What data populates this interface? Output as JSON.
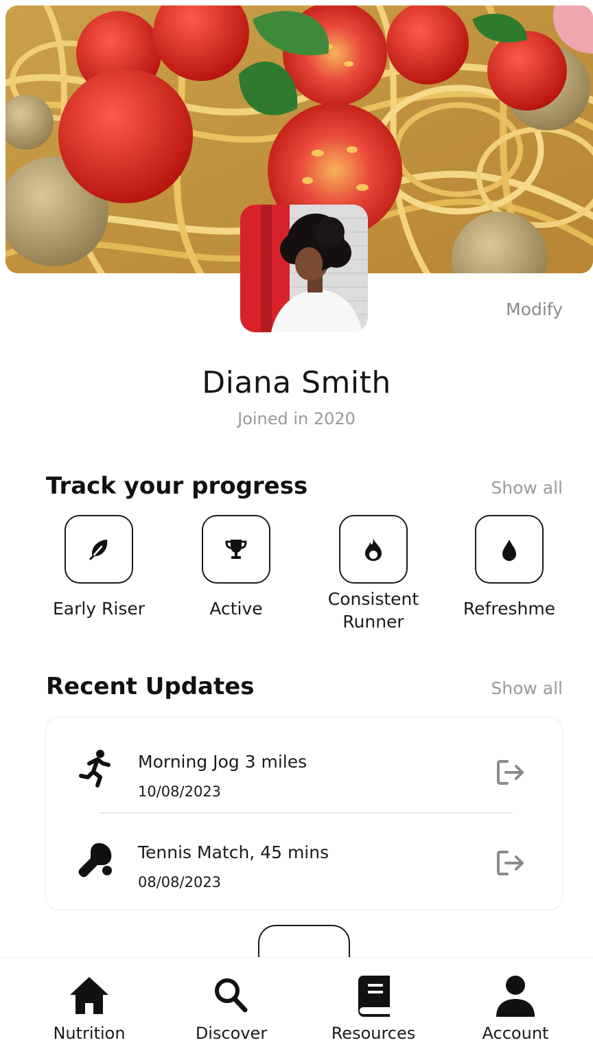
{
  "profile": {
    "modify_label": "Modify",
    "name": "Diana Smith",
    "joined": "Joined in 2020"
  },
  "progress": {
    "title": "Track your progress",
    "show_all": "Show all",
    "badges": [
      {
        "label": "Early Riser",
        "icon": "feather-icon"
      },
      {
        "label": "Active",
        "icon": "trophy-icon"
      },
      {
        "label": "Consistent Runner",
        "icon": "flame-icon"
      },
      {
        "label": "Refreshme",
        "icon": "water-drop-icon"
      }
    ]
  },
  "updates": {
    "title": "Recent Updates",
    "show_all": "Show all",
    "items": [
      {
        "title": "Morning Jog 3 miles",
        "date": "10/08/2023",
        "icon": "running-icon"
      },
      {
        "title": "Tennis Match, 45 mins",
        "date": "08/08/2023",
        "icon": "table-tennis-icon"
      }
    ]
  },
  "nav": {
    "items": [
      {
        "label": "Nutrition",
        "icon": "home-icon"
      },
      {
        "label": "Discover",
        "icon": "search-icon"
      },
      {
        "label": "Resources",
        "icon": "book-icon"
      },
      {
        "label": "Account",
        "icon": "user-icon"
      }
    ]
  },
  "colors": {
    "text": "#111111",
    "muted": "#9a9a9a",
    "border": "#1a1a1a"
  }
}
